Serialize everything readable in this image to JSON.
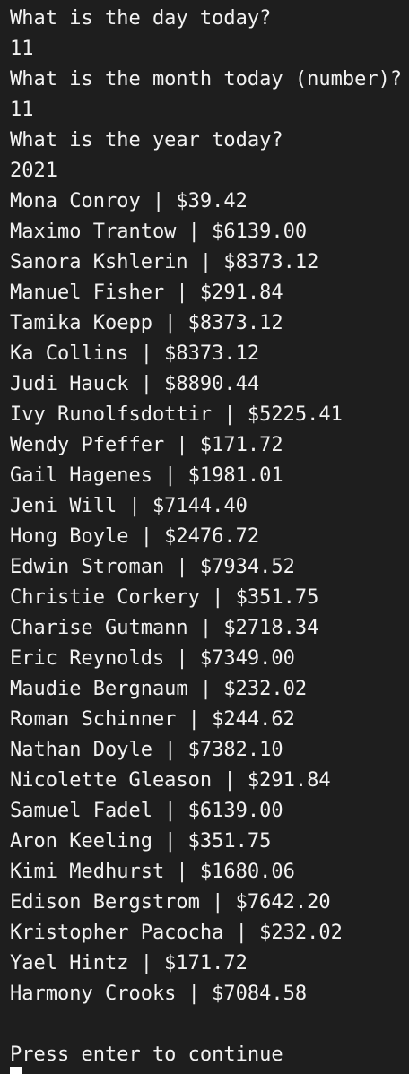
{
  "terminal": {
    "lines": [
      "What is the day today?",
      "11",
      "What is the month today (number)?",
      "11",
      "What is the year today?",
      "2021",
      "Mona Conroy | $39.42",
      "Maximo Trantow | $6139.00",
      "Sanora Kshlerin | $8373.12",
      "Manuel Fisher | $291.84",
      "Tamika Koepp | $8373.12",
      "Ka Collins | $8373.12",
      "Judi Hauck | $8890.44",
      "Ivy Runolfsdottir | $5225.41",
      "Wendy Pfeffer | $171.72",
      "Gail Hagenes | $1981.01",
      "Jeni Will | $7144.40",
      "Hong Boyle | $2476.72",
      "Edwin Stroman | $7934.52",
      "Christie Corkery | $351.75",
      "Charise Gutmann | $2718.34",
      "Eric Reynolds | $7349.00",
      "Maudie Bergnaum | $232.02",
      "Roman Schinner | $244.62",
      "Nathan Doyle | $7382.10",
      "Nicolette Gleason | $291.84",
      "Samuel Fadel | $6139.00",
      "Aron Keeling | $351.75",
      "Kimi Medhurst | $1680.06",
      "Edison Bergstrom | $7642.20",
      "Kristopher Pacocha | $232.02",
      "Yael Hintz | $171.72",
      "Harmony Crooks | $7084.58",
      "",
      "Press enter to continue"
    ]
  }
}
